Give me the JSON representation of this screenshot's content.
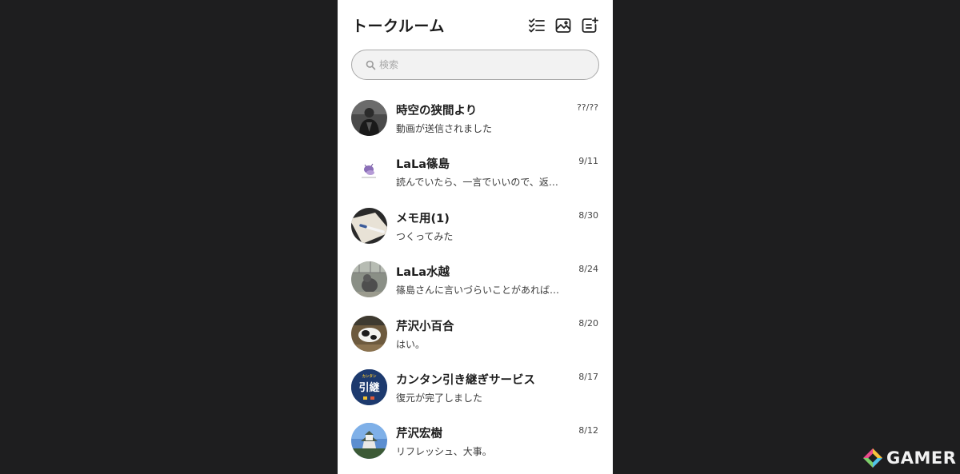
{
  "header": {
    "title": "トークルーム",
    "icons": [
      "checklist-icon",
      "image-icon",
      "new-chat-icon"
    ]
  },
  "search": {
    "placeholder": "検索"
  },
  "chats": [
    {
      "name": "時空の狭間より",
      "preview": "動画が送信されました",
      "date": "??/??",
      "avatar": "dark-figure"
    },
    {
      "name": "LaLa篠島",
      "preview": "読んでいたら、一言でいいので、返…",
      "date": "9/11",
      "avatar": "purple-illustration"
    },
    {
      "name": "メモ用(1)",
      "preview": "つくってみた",
      "date": "8/30",
      "avatar": "pen-on-paper"
    },
    {
      "name": "LaLa水越",
      "preview": "篠島さんに言いづらいことがあれば…",
      "date": "8/24",
      "avatar": "cat-outdoors"
    },
    {
      "name": "芹沢小百合",
      "preview": "はい。",
      "date": "8/20",
      "avatar": "cow"
    },
    {
      "name": "カンタン引き継ぎサービス",
      "preview": "復元が完了しました",
      "date": "8/17",
      "avatar": "handover-logo"
    },
    {
      "name": "芹沢宏樹",
      "preview": "リフレッシュ、大事。",
      "date": "8/12",
      "avatar": "castle"
    }
  ],
  "handover_logo": {
    "top": "カンタン",
    "main": "引継"
  },
  "watermark": {
    "text": "GAMER"
  }
}
